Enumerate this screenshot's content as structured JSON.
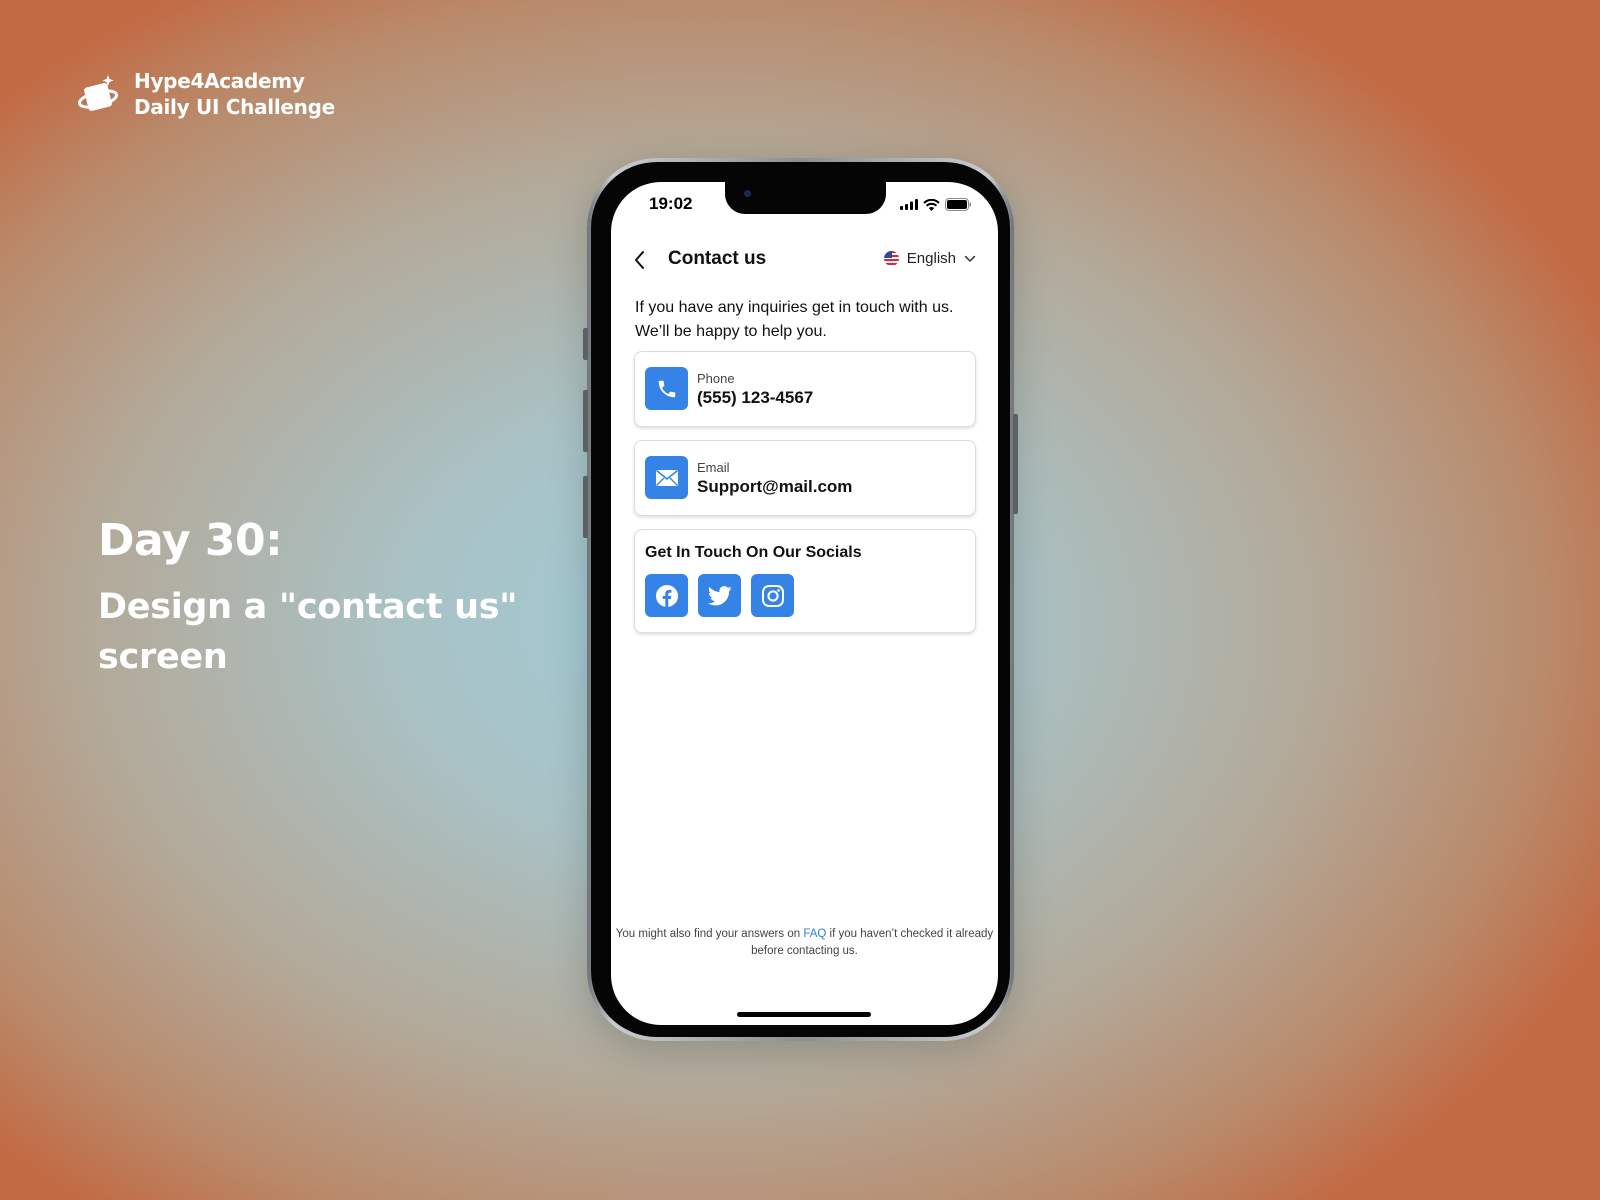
{
  "brand": {
    "name": "Hype4Academy",
    "subtitle": "Daily UI Challenge",
    "logo_icon": "planet-card-icon"
  },
  "hero": {
    "day": "Day 30:",
    "description": "Design a \"contact us\" screen"
  },
  "status_bar": {
    "time": "19:02",
    "icons": [
      "signal-icon",
      "wifi-icon",
      "battery-icon"
    ]
  },
  "nav": {
    "back_icon": "chevron-left-icon",
    "title": "Contact us",
    "language": {
      "flag_icon": "us-flag-icon",
      "selected": "English",
      "dropdown_icon": "chevron-down-icon"
    }
  },
  "intro": "If you have any inquiries get in touch with us. We’ll be happy to help you.",
  "contacts": [
    {
      "icon": "phone-icon",
      "label": "Phone",
      "value": "(555) 123-4567"
    },
    {
      "icon": "mail-icon",
      "label": "Email",
      "value": "Support@mail.com"
    }
  ],
  "socials": {
    "title": "Get In Touch On Our Socials",
    "items": [
      {
        "name": "Facebook",
        "icon": "facebook-icon"
      },
      {
        "name": "Twitter",
        "icon": "twitter-icon"
      },
      {
        "name": "Instagram",
        "icon": "instagram-icon"
      }
    ]
  },
  "footer": {
    "before": "You might also find your answers on ",
    "link": "FAQ",
    "after": " if you haven’t checked it already before contacting us."
  },
  "colors": {
    "accent": "#3583e6",
    "link": "#2f7ee0",
    "background_center": "#9fcbd6",
    "background_edge": "#c26a43"
  }
}
